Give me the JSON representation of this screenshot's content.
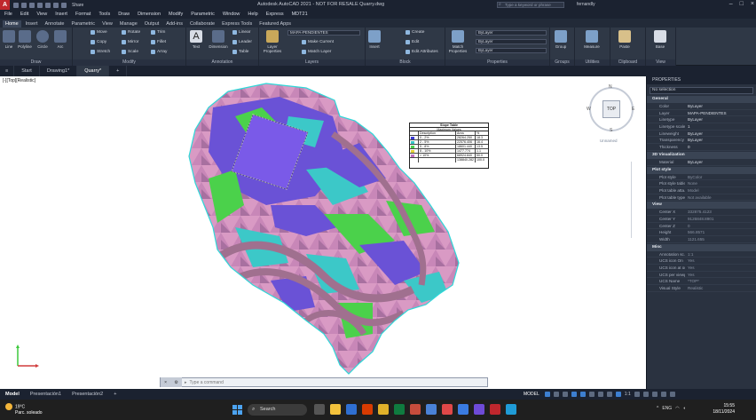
{
  "app": {
    "title": "Autodesk AutoCAD 2021 - NOT FOR RESALE   Quarry.dwg",
    "share_label": "Share",
    "search_placeholder": "Type a keyword or phrase",
    "user": "fernandly"
  },
  "menu": [
    "File",
    "Edit",
    "View",
    "Insert",
    "Format",
    "Tools",
    "Draw",
    "Dimension",
    "Modify",
    "Parametric",
    "Window",
    "Help",
    "Express",
    "MDT21"
  ],
  "ribbon_tabs": [
    "Home",
    "Insert",
    "Annotate",
    "Parametric",
    "View",
    "Manage",
    "Output",
    "Add-ins",
    "Collaborate",
    "Express Tools",
    "Featured Apps"
  ],
  "ribbon": {
    "draw": {
      "label": "Draw",
      "items": [
        "Line",
        "Polyline",
        "Circle",
        "Arc"
      ]
    },
    "modify": {
      "label": "Modify",
      "items": [
        "Move",
        "Rotate",
        "Trim",
        "Copy",
        "Mirror",
        "Fillet",
        "Stretch",
        "Scale",
        "Array"
      ]
    },
    "annotation": {
      "label": "Annotation",
      "items": [
        "Text",
        "Dimension",
        "Linear",
        "Leader",
        "Table"
      ]
    },
    "layers": {
      "label": "Layers",
      "layer_props": "Layer Properties",
      "current_layer": "MAPA-PENDIENTES",
      "items": [
        "Make Current",
        "Match Layer"
      ]
    },
    "block": {
      "label": "Block",
      "items": [
        "Insert",
        "Create",
        "Edit",
        "Edit Attributes"
      ]
    },
    "properties": {
      "label": "Properties",
      "match": "Match Properties",
      "bylayer": "ByLayer"
    },
    "groups": {
      "label": "Groups",
      "group": "Group"
    },
    "utilities": {
      "label": "Utilities",
      "measure": "Measure"
    },
    "clipboard": {
      "label": "Clipboard",
      "paste": "Paste"
    },
    "view": {
      "label": "View",
      "base": "Base"
    }
  },
  "doc_tabs": [
    "Start",
    "Drawing1*",
    "Quarry*"
  ],
  "viewport": {
    "label": "[-][Top][Realistic]",
    "viewcube_top": "TOP",
    "viewcube_n": "N",
    "viewcube_s": "S",
    "viewcube_e": "E",
    "viewcube_w": "W",
    "wcs": "Unnamed"
  },
  "slope_table": {
    "title": "Slope Table",
    "subtitle": "Maximum Values",
    "headers": [
      "",
      "Description",
      "Area",
      "%"
    ],
    "rows": [
      {
        "color": "#3c3cd6",
        "desc": "0 - 2%",
        "area": "28264.250",
        "pct": "18.3"
      },
      {
        "color": "#38c8c8",
        "desc": "2 - 5%",
        "area": "22576.406",
        "pct": "16.4"
      },
      {
        "color": "#4bd14b",
        "desc": "5 - 8%",
        "area": "18601.440",
        "pct": "13.5"
      },
      {
        "color": "#e6d23a",
        "desc": "8 - 10%",
        "area": "1477.774",
        "pct": "1.1"
      },
      {
        "color": "#c070c0",
        "desc": "> 10%",
        "area": "68924.840",
        "pct": "50.0"
      },
      {
        "color": "#ffffff",
        "desc": "",
        "area": "138840.282",
        "pct": "100.0"
      }
    ]
  },
  "command_line": {
    "placeholder": "Type a command"
  },
  "properties": {
    "title": "PROPERTIES",
    "selection": "No selection",
    "sections": [
      {
        "name": "General",
        "rows": [
          [
            "Color",
            "ByLayer"
          ],
          [
            "Layer",
            "MAPA-PENDIENTES"
          ],
          [
            "Linetype",
            "ByLayer"
          ],
          [
            "Linetype scale",
            "1"
          ],
          [
            "Lineweight",
            "ByLayer"
          ],
          [
            "Transparency",
            "ByLayer"
          ],
          [
            "Thickness",
            "0"
          ]
        ]
      },
      {
        "name": "3D Visualization",
        "rows": [
          [
            "Material",
            "ByLayer"
          ]
        ]
      },
      {
        "name": "Plot style",
        "rows": [
          [
            "Plot style",
            "ByColor"
          ],
          [
            "Plot style table",
            "None"
          ],
          [
            "Plot table atta...",
            "Model"
          ],
          [
            "Plot table type",
            "Not available"
          ]
        ]
      },
      {
        "name": "View",
        "rows": [
          [
            "Center X",
            "332875.4123"
          ],
          [
            "Center Y",
            "9126848.8901"
          ],
          [
            "Center Z",
            "0"
          ],
          [
            "Height",
            "566.8571"
          ],
          [
            "Width",
            "1121.655"
          ]
        ]
      },
      {
        "name": "Misc",
        "rows": [
          [
            "Annotation sc...",
            "1:1"
          ],
          [
            "UCS icon On",
            "Yes"
          ],
          [
            "UCS icon at or...",
            "Yes"
          ],
          [
            "UCS per viewp...",
            "Yes"
          ],
          [
            "UCS Name",
            "*TOP*"
          ],
          [
            "Visual Style",
            "Realistic"
          ]
        ]
      }
    ]
  },
  "layout_tabs": [
    "Model",
    "Presentación1",
    "Presentación2"
  ],
  "status": {
    "model": "MODEL",
    "scale": "1:1"
  },
  "taskbar": {
    "temp": "19°C",
    "weather": "Parc. soleado",
    "search": "Search",
    "lang": "ENG",
    "time": "15:55",
    "date": "18/11/2024"
  }
}
